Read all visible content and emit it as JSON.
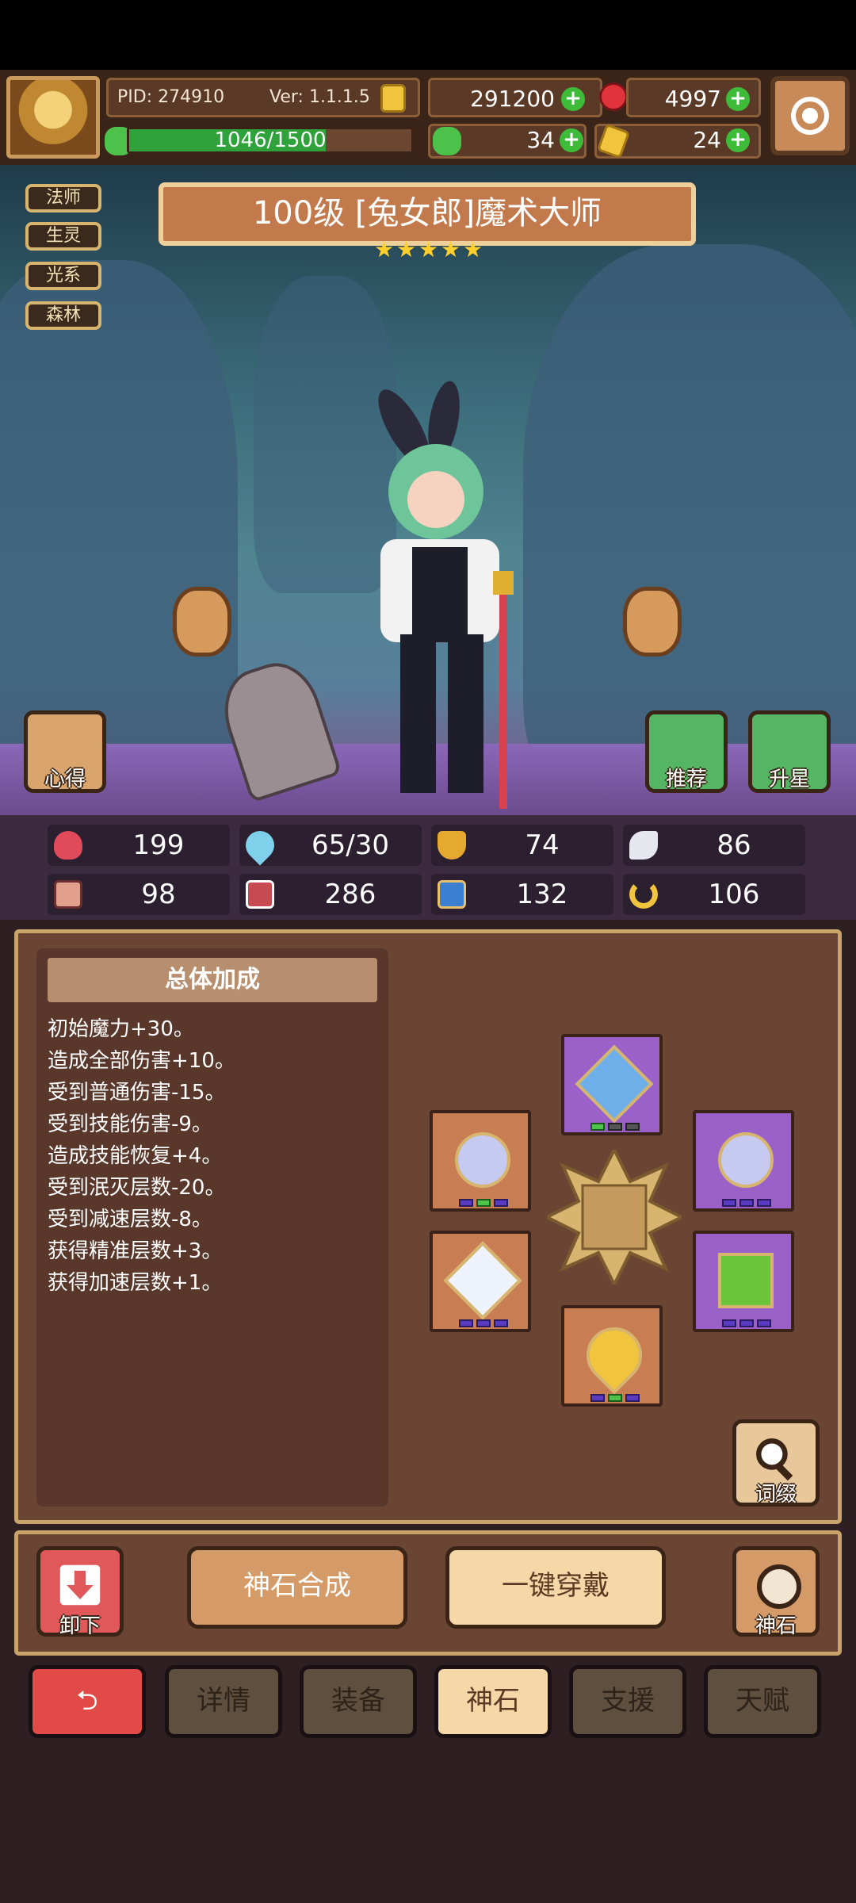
{
  "header": {
    "pid": "PID: 274910",
    "version": "Ver: 1.1.1.5",
    "gold": "291200",
    "gems": "4997",
    "xp": "1046/1500",
    "xp_progress": 0.6973,
    "clover": "34",
    "horn": "24"
  },
  "tags": [
    "法师",
    "生灵",
    "光系",
    "森林"
  ],
  "character": {
    "title": "100级 [兔女郎]魔术大师",
    "stars": 5
  },
  "side_buttons": {
    "notes": "心得",
    "recommend": "推荐",
    "star_up": "升星"
  },
  "stats": [
    {
      "icon": "heart-icon",
      "value": "199"
    },
    {
      "icon": "mana-drop-icon",
      "value": "65/30"
    },
    {
      "icon": "shield-icon",
      "value": "74"
    },
    {
      "icon": "wing-icon",
      "value": "86"
    },
    {
      "icon": "fist-icon",
      "value": "98"
    },
    {
      "icon": "book-icon",
      "value": "286"
    },
    {
      "icon": "boot-icon",
      "value": "132"
    },
    {
      "icon": "horseshoe-icon",
      "value": "106"
    }
  ],
  "bonus": {
    "title": "总体加成",
    "lines": [
      "初始魔力+30。",
      "造成全部伤害+10。",
      "受到普通伤害-15。",
      "受到技能伤害-9。",
      "造成技能恢复+4。",
      "受到泯灭层数-20。",
      "受到减速层数-8。",
      "获得精准层数+3。",
      "获得加速层数+1。"
    ]
  },
  "affix_label": "词缀",
  "actions": {
    "unequip": "卸下",
    "synthesize": "神石合成",
    "equip_all": "一键穿戴",
    "stone": "神石"
  },
  "tabs": [
    "详情",
    "装备",
    "神石",
    "支援",
    "天赋"
  ],
  "colors": {
    "accent_gold": "#d8b56f",
    "panel_brown": "#6b4533",
    "back_red": "#e24a47",
    "active_tab": "#f6d7a8"
  }
}
